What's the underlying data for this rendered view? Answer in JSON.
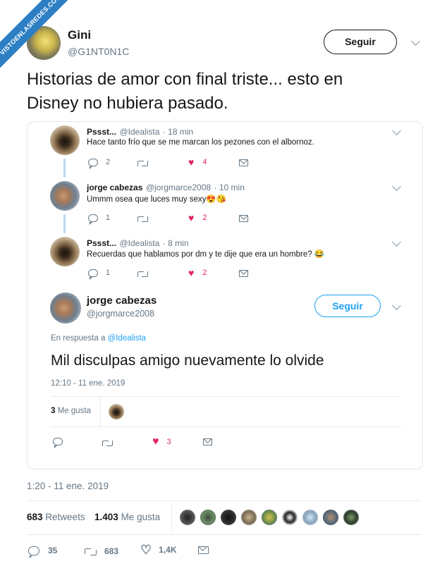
{
  "watermark": "VISTOENLASREDES.COM",
  "main_tweet": {
    "author_name": "Gini",
    "author_handle": "@G1NT0N1C",
    "follow_label": "Seguir",
    "text_line1": "Historias de amor con final triste... esto en",
    "text_line2": "Disney no hubiera pasado.",
    "timestamp": "1:20 - 11 ene. 2019",
    "retweets_count": "683",
    "retweets_label": "Retweets",
    "likes_count": "1.403",
    "likes_label": "Me gusta",
    "actions": {
      "replies": "35",
      "retweets": "683",
      "likes": "1,4K"
    }
  },
  "quoted_thread": [
    {
      "name": "Pssst...",
      "handle": "@Idealista",
      "time": "· 18 min",
      "text": "Hace tanto frío que se me marcan los pezones con el albornoz.",
      "replies": "2",
      "likes": "4"
    },
    {
      "name": "jorge cabezas",
      "handle": "@jorgmarce2008",
      "time": "· 10 min",
      "text": "Ummm osea que luces muy sexy😍😘",
      "replies": "1",
      "likes": "2"
    },
    {
      "name": "Pssst...",
      "handle": "@Idealista",
      "time": "· 8 min",
      "text": "Recuerdas que hablamos por dm y te dije que era un hombre? 😂",
      "replies": "1",
      "likes": "2"
    }
  ],
  "quoted_focus": {
    "name": "jorge cabezas",
    "handle": "@jorgmarce2008",
    "follow_label": "Seguir",
    "reply_prefix": "En respuesta a",
    "reply_to": "@Idealista",
    "text": "Mil disculpas amigo nuevamente lo olvide",
    "timestamp": "12:10 - 11 ene. 2019",
    "likes_count": "3",
    "likes_label": "Me gusta",
    "actions_likes": "3"
  },
  "colors": {
    "accent": "#1da1f2",
    "like": "#e0245e",
    "muted": "#657786",
    "watermark": "#2d7fc4"
  }
}
